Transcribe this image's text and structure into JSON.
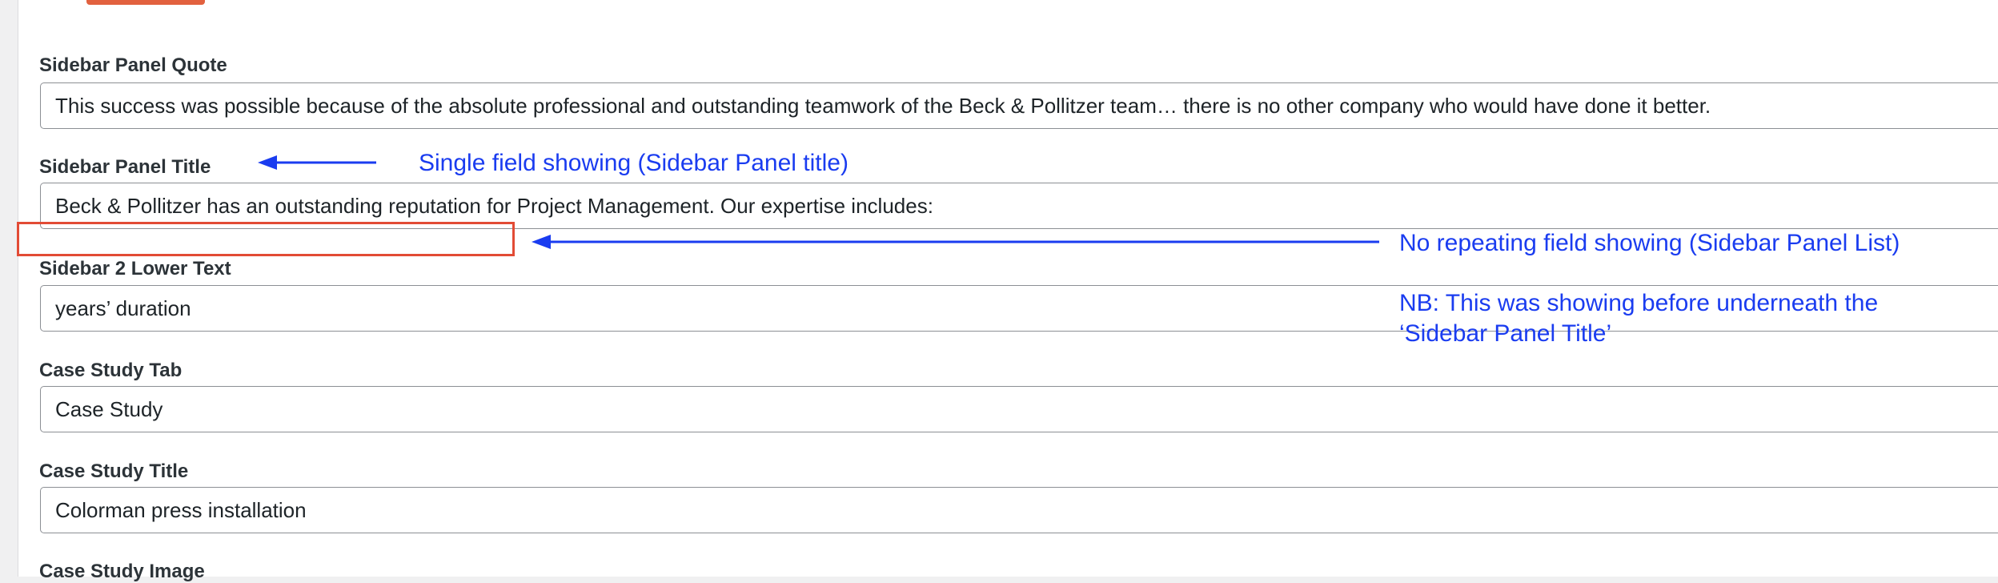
{
  "fields": [
    {
      "label": "Sidebar Panel Quote",
      "value": "This success was possible because of the absolute professional and outstanding teamwork of the Beck & Pollitzer team… there is no other company who would have done it better."
    },
    {
      "label": "Sidebar Panel Title",
      "value": "Beck & Pollitzer has an outstanding reputation for Project Management. Our expertise includes:"
    },
    {
      "label": "Sidebar 2 Lower Text",
      "value": "years’ duration"
    },
    {
      "label": "Case Study Tab",
      "value": "Case Study"
    },
    {
      "label": "Case Study Title",
      "value": "Colorman press installation"
    },
    {
      "label": "Case Study Image",
      "value": ""
    }
  ],
  "annotations": {
    "single_field": "Single field showing (Sidebar Panel title)",
    "no_repeating": "No repeating field showing (Sidebar Panel List)",
    "note_line1": "NB: This was showing before underneath the",
    "note_line2": "‘Sidebar Panel Title’"
  },
  "colors": {
    "annotation": "#1a3cf0",
    "highlight": "#e24b35",
    "button": "#e2613f"
  }
}
